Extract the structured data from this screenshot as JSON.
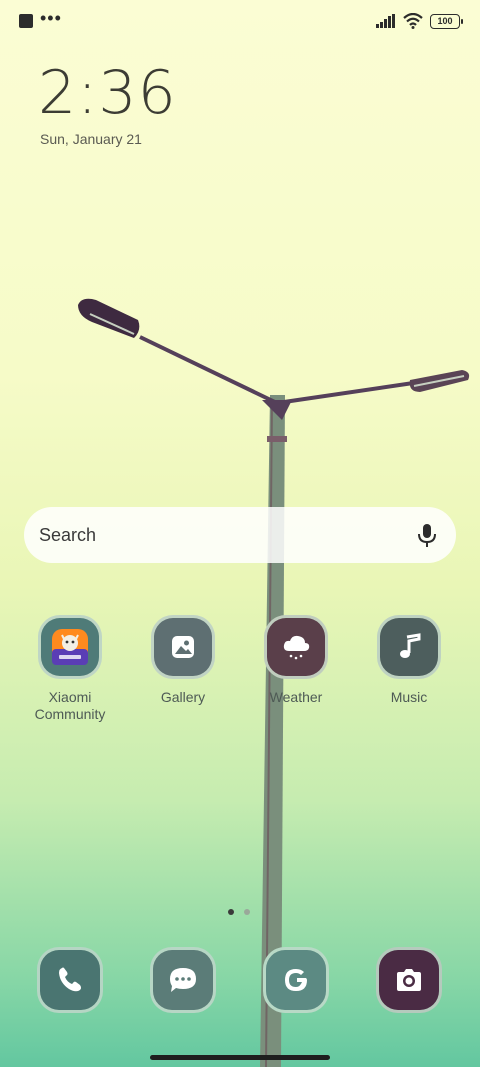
{
  "status_bar": {
    "battery": "100"
  },
  "lockscreen": {
    "time": "2:36",
    "date": "Sun, January 21"
  },
  "search": {
    "placeholder": "Search"
  },
  "apps": [
    {
      "label": "Xiaomi\nCommunity",
      "icon": "xiaomi-community-icon",
      "color": "#4f7b78"
    },
    {
      "label": "Gallery",
      "icon": "gallery-icon",
      "color": "#5e6f72"
    },
    {
      "label": "Weather",
      "icon": "weather-icon",
      "color": "#5a3f4a"
    },
    {
      "label": "Music",
      "icon": "music-icon",
      "color": "#4d5e5d"
    }
  ],
  "dock": [
    {
      "icon": "phone-icon",
      "color": "#4a7571"
    },
    {
      "icon": "messages-icon",
      "color": "#5b7c78"
    },
    {
      "icon": "google-icon",
      "color": "#5c8a83"
    },
    {
      "icon": "camera-icon",
      "color": "#4a2b44"
    }
  ],
  "page_indicator": {
    "pages": 2,
    "current": 1
  }
}
